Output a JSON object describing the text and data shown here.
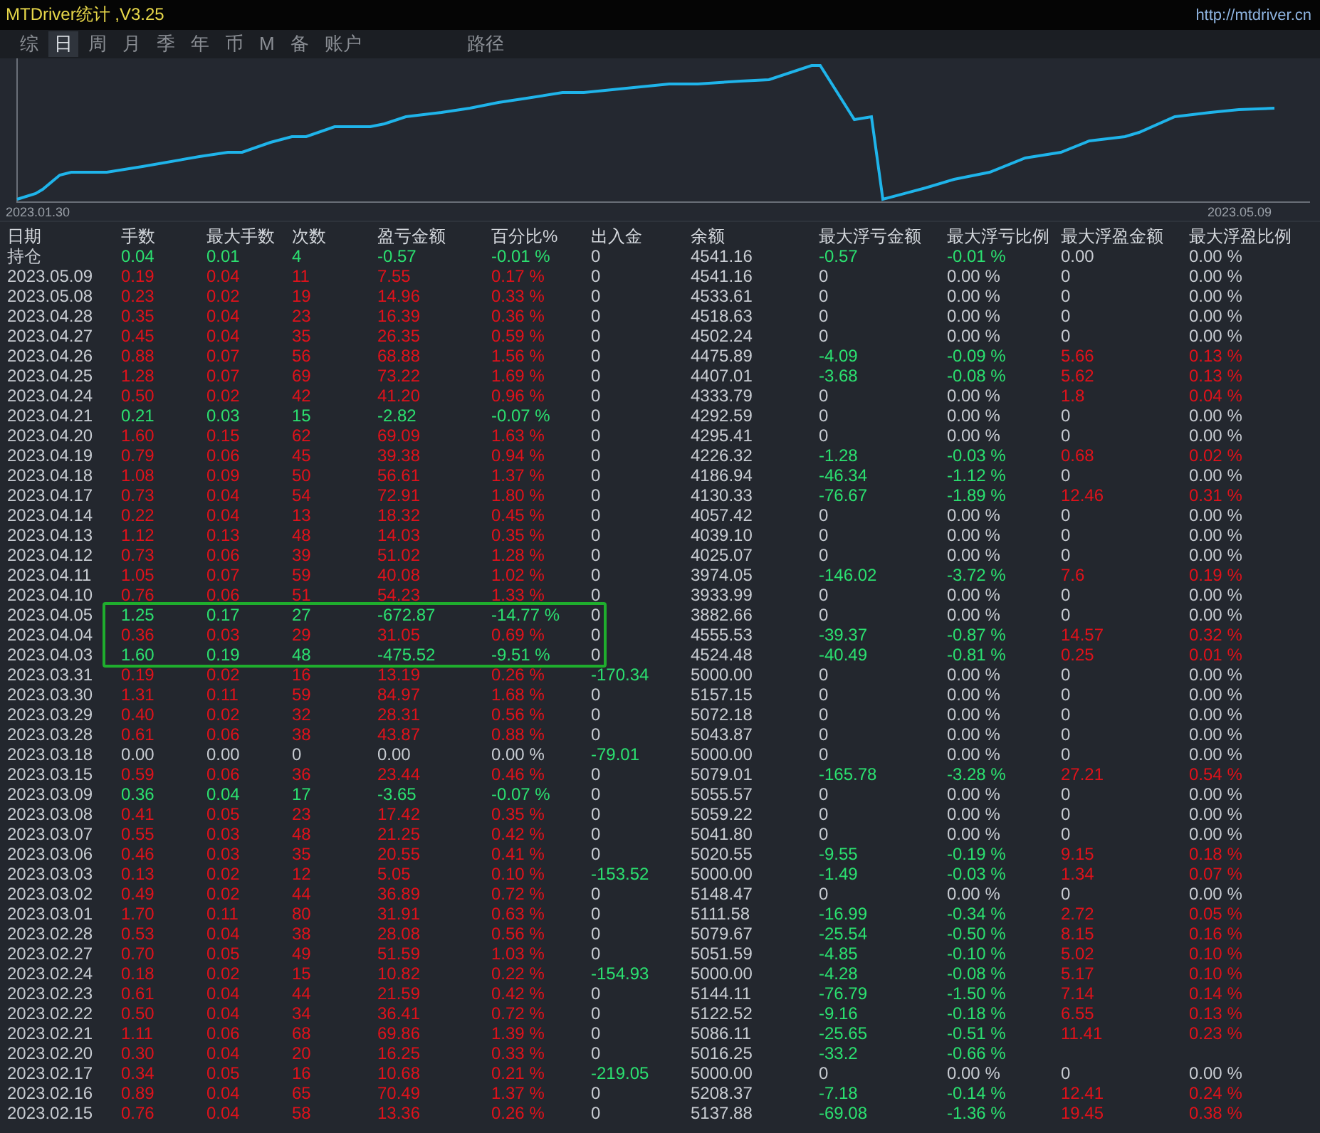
{
  "window": {
    "title": "MTDriver统计 ,V3.25",
    "url": "http://mtdriver.cn"
  },
  "tabs": [
    {
      "label": "综",
      "selected": false
    },
    {
      "label": "日",
      "selected": true
    },
    {
      "label": "周",
      "selected": false
    },
    {
      "label": "月",
      "selected": false
    },
    {
      "label": "季",
      "selected": false
    },
    {
      "label": "年",
      "selected": false
    },
    {
      "label": "币",
      "selected": false
    },
    {
      "label": "M",
      "selected": false
    },
    {
      "label": "备",
      "selected": false
    },
    {
      "label": "账户",
      "selected": false
    }
  ],
  "extra_tabs": [
    {
      "label": "路径",
      "selected": false
    }
  ],
  "chart": {
    "start_label": "2023.01.30",
    "end_label": "2023.05.09"
  },
  "columns": [
    "日期",
    "手数",
    "最大手数",
    "次数",
    "盈亏金额",
    "百分比%",
    "出入金",
    "余额",
    "最大浮亏金额",
    "最大浮亏比例",
    "最大浮盈金额",
    "最大浮盈比例"
  ],
  "rows": [
    {
      "date": "持仓",
      "highlighted": false,
      "cells": [
        {
          "text": "0.04",
          "color": "#2be070"
        },
        {
          "text": "0.01",
          "color": "#2be070"
        },
        {
          "text": "4",
          "color": "#2be070"
        },
        {
          "text": "-0.57",
          "color": "#2be070"
        },
        {
          "text": "-0.01 %",
          "color": "#2be070"
        },
        {
          "text": "0"
        },
        {
          "text": "4541.16"
        },
        {
          "text": "-0.57",
          "color": "#2be070"
        },
        {
          "text": "-0.01 %",
          "color": "#2be070"
        },
        {
          "text": "0.00"
        },
        {
          "text": "0.00 %"
        }
      ]
    },
    {
      "date": "2023.05.09",
      "highlighted": false,
      "cells": [
        {
          "text": "0.19",
          "color": "#e0121b"
        },
        {
          "text": "0.04",
          "color": "#e0121b"
        },
        {
          "text": "11",
          "color": "#e0121b"
        },
        {
          "text": "7.55",
          "color": "#e0121b"
        },
        {
          "text": "0.17 %",
          "color": "#e0121b"
        },
        {
          "text": "0"
        },
        {
          "text": "4541.16"
        },
        {
          "text": "0"
        },
        {
          "text": "0.00 %"
        },
        {
          "text": "0"
        },
        {
          "text": "0.00 %"
        }
      ]
    },
    {
      "date": "2023.05.08",
      "highlighted": false,
      "cells": [
        {
          "text": "0.23",
          "color": "#e0121b"
        },
        {
          "text": "0.02",
          "color": "#e0121b"
        },
        {
          "text": "19",
          "color": "#e0121b"
        },
        {
          "text": "14.96",
          "color": "#e0121b"
        },
        {
          "text": "0.33 %",
          "color": "#e0121b"
        },
        {
          "text": "0"
        },
        {
          "text": "4533.61"
        },
        {
          "text": "0"
        },
        {
          "text": "0.00 %"
        },
        {
          "text": "0"
        },
        {
          "text": "0.00 %"
        }
      ]
    },
    {
      "date": "2023.04.28",
      "highlighted": false,
      "cells": [
        {
          "text": "0.35",
          "color": "#e0121b"
        },
        {
          "text": "0.04",
          "color": "#e0121b"
        },
        {
          "text": "23",
          "color": "#e0121b"
        },
        {
          "text": "16.39",
          "color": "#e0121b"
        },
        {
          "text": "0.36 %",
          "color": "#e0121b"
        },
        {
          "text": "0"
        },
        {
          "text": "4518.63"
        },
        {
          "text": "0"
        },
        {
          "text": "0.00 %"
        },
        {
          "text": "0"
        },
        {
          "text": "0.00 %"
        }
      ]
    },
    {
      "date": "2023.04.27",
      "highlighted": false,
      "cells": [
        {
          "text": "0.45",
          "color": "#e0121b"
        },
        {
          "text": "0.04",
          "color": "#e0121b"
        },
        {
          "text": "35",
          "color": "#e0121b"
        },
        {
          "text": "26.35",
          "color": "#e0121b"
        },
        {
          "text": "0.59 %",
          "color": "#e0121b"
        },
        {
          "text": "0"
        },
        {
          "text": "4502.24"
        },
        {
          "text": "0"
        },
        {
          "text": "0.00 %"
        },
        {
          "text": "0"
        },
        {
          "text": "0.00 %"
        }
      ]
    },
    {
      "date": "2023.04.26",
      "highlighted": false,
      "cells": [
        {
          "text": "0.88",
          "color": "#e0121b"
        },
        {
          "text": "0.07",
          "color": "#e0121b"
        },
        {
          "text": "56",
          "color": "#e0121b"
        },
        {
          "text": "68.88",
          "color": "#e0121b"
        },
        {
          "text": "1.56 %",
          "color": "#e0121b"
        },
        {
          "text": "0"
        },
        {
          "text": "4475.89"
        },
        {
          "text": "-4.09",
          "color": "#2be070"
        },
        {
          "text": "-0.09 %",
          "color": "#2be070"
        },
        {
          "text": "5.66",
          "color": "#e0121b"
        },
        {
          "text": "0.13 %",
          "color": "#e0121b"
        }
      ]
    },
    {
      "date": "2023.04.25",
      "highlighted": false,
      "cells": [
        {
          "text": "1.28",
          "color": "#e0121b"
        },
        {
          "text": "0.07",
          "color": "#e0121b"
        },
        {
          "text": "69",
          "color": "#e0121b"
        },
        {
          "text": "73.22",
          "color": "#e0121b"
        },
        {
          "text": "1.69 %",
          "color": "#e0121b"
        },
        {
          "text": "0"
        },
        {
          "text": "4407.01"
        },
        {
          "text": "-3.68",
          "color": "#2be070"
        },
        {
          "text": "-0.08 %",
          "color": "#2be070"
        },
        {
          "text": "5.62",
          "color": "#e0121b"
        },
        {
          "text": "0.13 %",
          "color": "#e0121b"
        }
      ]
    },
    {
      "date": "2023.04.24",
      "highlighted": false,
      "cells": [
        {
          "text": "0.50",
          "color": "#e0121b"
        },
        {
          "text": "0.02",
          "color": "#e0121b"
        },
        {
          "text": "42",
          "color": "#e0121b"
        },
        {
          "text": "41.20",
          "color": "#e0121b"
        },
        {
          "text": "0.96 %",
          "color": "#e0121b"
        },
        {
          "text": "0"
        },
        {
          "text": "4333.79"
        },
        {
          "text": "0"
        },
        {
          "text": "0.00 %"
        },
        {
          "text": "1.8",
          "color": "#e0121b"
        },
        {
          "text": "0.04 %",
          "color": "#e0121b"
        }
      ]
    },
    {
      "date": "2023.04.21",
      "highlighted": false,
      "cells": [
        {
          "text": "0.21",
          "color": "#2be070"
        },
        {
          "text": "0.03",
          "color": "#2be070"
        },
        {
          "text": "15",
          "color": "#2be070"
        },
        {
          "text": "-2.82",
          "color": "#2be070"
        },
        {
          "text": "-0.07 %",
          "color": "#2be070"
        },
        {
          "text": "0"
        },
        {
          "text": "4292.59"
        },
        {
          "text": "0"
        },
        {
          "text": "0.00 %"
        },
        {
          "text": "0"
        },
        {
          "text": "0.00 %"
        }
      ]
    },
    {
      "date": "2023.04.20",
      "highlighted": false,
      "cells": [
        {
          "text": "1.60",
          "color": "#e0121b"
        },
        {
          "text": "0.15",
          "color": "#e0121b"
        },
        {
          "text": "62",
          "color": "#e0121b"
        },
        {
          "text": "69.09",
          "color": "#e0121b"
        },
        {
          "text": "1.63 %",
          "color": "#e0121b"
        },
        {
          "text": "0"
        },
        {
          "text": "4295.41"
        },
        {
          "text": "0"
        },
        {
          "text": "0.00 %"
        },
        {
          "text": "0"
        },
        {
          "text": "0.00 %"
        }
      ]
    },
    {
      "date": "2023.04.19",
      "highlighted": false,
      "cells": [
        {
          "text": "0.79",
          "color": "#e0121b"
        },
        {
          "text": "0.06",
          "color": "#e0121b"
        },
        {
          "text": "45",
          "color": "#e0121b"
        },
        {
          "text": "39.38",
          "color": "#e0121b"
        },
        {
          "text": "0.94 %",
          "color": "#e0121b"
        },
        {
          "text": "0"
        },
        {
          "text": "4226.32"
        },
        {
          "text": "-1.28",
          "color": "#2be070"
        },
        {
          "text": "-0.03 %",
          "color": "#2be070"
        },
        {
          "text": "0.68",
          "color": "#e0121b"
        },
        {
          "text": "0.02 %",
          "color": "#e0121b"
        }
      ]
    },
    {
      "date": "2023.04.18",
      "highlighted": false,
      "cells": [
        {
          "text": "1.08",
          "color": "#e0121b"
        },
        {
          "text": "0.09",
          "color": "#e0121b"
        },
        {
          "text": "50",
          "color": "#e0121b"
        },
        {
          "text": "56.61",
          "color": "#e0121b"
        },
        {
          "text": "1.37 %",
          "color": "#e0121b"
        },
        {
          "text": "0"
        },
        {
          "text": "4186.94"
        },
        {
          "text": "-46.34",
          "color": "#2be070"
        },
        {
          "text": "-1.12 %",
          "color": "#2be070"
        },
        {
          "text": "0"
        },
        {
          "text": "0.00 %"
        }
      ]
    },
    {
      "date": "2023.04.17",
      "highlighted": false,
      "cells": [
        {
          "text": "0.73",
          "color": "#e0121b"
        },
        {
          "text": "0.04",
          "color": "#e0121b"
        },
        {
          "text": "54",
          "color": "#e0121b"
        },
        {
          "text": "72.91",
          "color": "#e0121b"
        },
        {
          "text": "1.80 %",
          "color": "#e0121b"
        },
        {
          "text": "0"
        },
        {
          "text": "4130.33"
        },
        {
          "text": "-76.67",
          "color": "#2be070"
        },
        {
          "text": "-1.89 %",
          "color": "#2be070"
        },
        {
          "text": "12.46",
          "color": "#e0121b"
        },
        {
          "text": "0.31 %",
          "color": "#e0121b"
        }
      ]
    },
    {
      "date": "2023.04.14",
      "highlighted": false,
      "cells": [
        {
          "text": "0.22",
          "color": "#e0121b"
        },
        {
          "text": "0.04",
          "color": "#e0121b"
        },
        {
          "text": "13",
          "color": "#e0121b"
        },
        {
          "text": "18.32",
          "color": "#e0121b"
        },
        {
          "text": "0.45 %",
          "color": "#e0121b"
        },
        {
          "text": "0"
        },
        {
          "text": "4057.42"
        },
        {
          "text": "0"
        },
        {
          "text": "0.00 %"
        },
        {
          "text": "0"
        },
        {
          "text": "0.00 %"
        }
      ]
    },
    {
      "date": "2023.04.13",
      "highlighted": false,
      "cells": [
        {
          "text": "1.12",
          "color": "#e0121b"
        },
        {
          "text": "0.13",
          "color": "#e0121b"
        },
        {
          "text": "48",
          "color": "#e0121b"
        },
        {
          "text": "14.03",
          "color": "#e0121b"
        },
        {
          "text": "0.35 %",
          "color": "#e0121b"
        },
        {
          "text": "0"
        },
        {
          "text": "4039.10"
        },
        {
          "text": "0"
        },
        {
          "text": "0.00 %"
        },
        {
          "text": "0"
        },
        {
          "text": "0.00 %"
        }
      ]
    },
    {
      "date": "2023.04.12",
      "highlighted": false,
      "cells": [
        {
          "text": "0.73",
          "color": "#e0121b"
        },
        {
          "text": "0.06",
          "color": "#e0121b"
        },
        {
          "text": "39",
          "color": "#e0121b"
        },
        {
          "text": "51.02",
          "color": "#e0121b"
        },
        {
          "text": "1.28 %",
          "color": "#e0121b"
        },
        {
          "text": "0"
        },
        {
          "text": "4025.07"
        },
        {
          "text": "0"
        },
        {
          "text": "0.00 %"
        },
        {
          "text": "0"
        },
        {
          "text": "0.00 %"
        }
      ]
    },
    {
      "date": "2023.04.11",
      "highlighted": false,
      "cells": [
        {
          "text": "1.05",
          "color": "#e0121b"
        },
        {
          "text": "0.07",
          "color": "#e0121b"
        },
        {
          "text": "59",
          "color": "#e0121b"
        },
        {
          "text": "40.08",
          "color": "#e0121b"
        },
        {
          "text": "1.02 %",
          "color": "#e0121b"
        },
        {
          "text": "0"
        },
        {
          "text": "3974.05"
        },
        {
          "text": "-146.02",
          "color": "#2be070"
        },
        {
          "text": "-3.72 %",
          "color": "#2be070"
        },
        {
          "text": "7.6",
          "color": "#e0121b"
        },
        {
          "text": "0.19 %",
          "color": "#e0121b"
        }
      ]
    },
    {
      "date": "2023.04.10",
      "highlighted": false,
      "cells": [
        {
          "text": "0.76",
          "color": "#e0121b"
        },
        {
          "text": "0.06",
          "color": "#e0121b"
        },
        {
          "text": "51",
          "color": "#e0121b"
        },
        {
          "text": "54.23",
          "color": "#e0121b"
        },
        {
          "text": "1.33 %",
          "color": "#e0121b"
        },
        {
          "text": "0"
        },
        {
          "text": "3933.99"
        },
        {
          "text": "0"
        },
        {
          "text": "0.00 %"
        },
        {
          "text": "0"
        },
        {
          "text": "0.00 %"
        }
      ]
    },
    {
      "date": "2023.04.05",
      "highlighted": true,
      "cells": [
        {
          "text": "1.25",
          "color": "#2be070"
        },
        {
          "text": "0.17",
          "color": "#2be070"
        },
        {
          "text": "27",
          "color": "#2be070"
        },
        {
          "text": "-672.87",
          "color": "#2be070"
        },
        {
          "text": "-14.77 %",
          "color": "#2be070"
        },
        {
          "text": "0"
        },
        {
          "text": "3882.66"
        },
        {
          "text": "0"
        },
        {
          "text": "0.00 %"
        },
        {
          "text": "0"
        },
        {
          "text": "0.00 %"
        }
      ]
    },
    {
      "date": "2023.04.04",
      "highlighted": true,
      "cells": [
        {
          "text": "0.36",
          "color": "#e0121b"
        },
        {
          "text": "0.03",
          "color": "#e0121b"
        },
        {
          "text": "29",
          "color": "#e0121b"
        },
        {
          "text": "31.05",
          "color": "#e0121b"
        },
        {
          "text": "0.69 %",
          "color": "#e0121b"
        },
        {
          "text": "0"
        },
        {
          "text": "4555.53"
        },
        {
          "text": "-39.37",
          "color": "#2be070"
        },
        {
          "text": "-0.87 %",
          "color": "#2be070"
        },
        {
          "text": "14.57",
          "color": "#e0121b"
        },
        {
          "text": "0.32 %",
          "color": "#e0121b"
        }
      ]
    },
    {
      "date": "2023.04.03",
      "highlighted": true,
      "cells": [
        {
          "text": "1.60",
          "color": "#2be070"
        },
        {
          "text": "0.19",
          "color": "#2be070"
        },
        {
          "text": "48",
          "color": "#2be070"
        },
        {
          "text": "-475.52",
          "color": "#2be070"
        },
        {
          "text": "-9.51 %",
          "color": "#2be070"
        },
        {
          "text": "0"
        },
        {
          "text": "4524.48"
        },
        {
          "text": "-40.49",
          "color": "#2be070"
        },
        {
          "text": "-0.81 %",
          "color": "#2be070"
        },
        {
          "text": "0.25",
          "color": "#e0121b"
        },
        {
          "text": "0.01 %",
          "color": "#e0121b"
        }
      ]
    },
    {
      "date": "2023.03.31",
      "highlighted": false,
      "cells": [
        {
          "text": "0.19",
          "color": "#e0121b"
        },
        {
          "text": "0.02",
          "color": "#e0121b"
        },
        {
          "text": "16",
          "color": "#e0121b"
        },
        {
          "text": "13.19",
          "color": "#e0121b"
        },
        {
          "text": "0.26 %",
          "color": "#e0121b"
        },
        {
          "text": "-170.34",
          "color": "#2be070"
        },
        {
          "text": "5000.00"
        },
        {
          "text": "0"
        },
        {
          "text": "0.00 %"
        },
        {
          "text": "0"
        },
        {
          "text": "0.00 %"
        }
      ]
    },
    {
      "date": "2023.03.30",
      "highlighted": false,
      "cells": [
        {
          "text": "1.31",
          "color": "#e0121b"
        },
        {
          "text": "0.11",
          "color": "#e0121b"
        },
        {
          "text": "59",
          "color": "#e0121b"
        },
        {
          "text": "84.97",
          "color": "#e0121b"
        },
        {
          "text": "1.68 %",
          "color": "#e0121b"
        },
        {
          "text": "0"
        },
        {
          "text": "5157.15"
        },
        {
          "text": "0"
        },
        {
          "text": "0.00 %"
        },
        {
          "text": "0"
        },
        {
          "text": "0.00 %"
        }
      ]
    },
    {
      "date": "2023.03.29",
      "highlighted": false,
      "cells": [
        {
          "text": "0.40",
          "color": "#e0121b"
        },
        {
          "text": "0.02",
          "color": "#e0121b"
        },
        {
          "text": "32",
          "color": "#e0121b"
        },
        {
          "text": "28.31",
          "color": "#e0121b"
        },
        {
          "text": "0.56 %",
          "color": "#e0121b"
        },
        {
          "text": "0"
        },
        {
          "text": "5072.18"
        },
        {
          "text": "0"
        },
        {
          "text": "0.00 %"
        },
        {
          "text": "0"
        },
        {
          "text": "0.00 %"
        }
      ]
    },
    {
      "date": "2023.03.28",
      "highlighted": false,
      "cells": [
        {
          "text": "0.61",
          "color": "#e0121b"
        },
        {
          "text": "0.06",
          "color": "#e0121b"
        },
        {
          "text": "38",
          "color": "#e0121b"
        },
        {
          "text": "43.87",
          "color": "#e0121b"
        },
        {
          "text": "0.88 %",
          "color": "#e0121b"
        },
        {
          "text": "0"
        },
        {
          "text": "5043.87"
        },
        {
          "text": "0"
        },
        {
          "text": "0.00 %"
        },
        {
          "text": "0"
        },
        {
          "text": "0.00 %"
        }
      ]
    },
    {
      "date": "2023.03.18",
      "highlighted": false,
      "cells": [
        {
          "text": "0.00"
        },
        {
          "text": "0.00"
        },
        {
          "text": "0"
        },
        {
          "text": "0.00"
        },
        {
          "text": "0.00 %"
        },
        {
          "text": "-79.01",
          "color": "#2be070"
        },
        {
          "text": "5000.00"
        },
        {
          "text": "0"
        },
        {
          "text": "0.00 %"
        },
        {
          "text": "0"
        },
        {
          "text": "0.00 %"
        }
      ]
    },
    {
      "date": "2023.03.15",
      "highlighted": false,
      "cells": [
        {
          "text": "0.59",
          "color": "#e0121b"
        },
        {
          "text": "0.06",
          "color": "#e0121b"
        },
        {
          "text": "36",
          "color": "#e0121b"
        },
        {
          "text": "23.44",
          "color": "#e0121b"
        },
        {
          "text": "0.46 %",
          "color": "#e0121b"
        },
        {
          "text": "0"
        },
        {
          "text": "5079.01"
        },
        {
          "text": "-165.78",
          "color": "#2be070"
        },
        {
          "text": "-3.28 %",
          "color": "#2be070"
        },
        {
          "text": "27.21",
          "color": "#e0121b"
        },
        {
          "text": "0.54 %",
          "color": "#e0121b"
        }
      ]
    },
    {
      "date": "2023.03.09",
      "highlighted": false,
      "cells": [
        {
          "text": "0.36",
          "color": "#2be070"
        },
        {
          "text": "0.04",
          "color": "#2be070"
        },
        {
          "text": "17",
          "color": "#2be070"
        },
        {
          "text": "-3.65",
          "color": "#2be070"
        },
        {
          "text": "-0.07 %",
          "color": "#2be070"
        },
        {
          "text": "0"
        },
        {
          "text": "5055.57"
        },
        {
          "text": "0"
        },
        {
          "text": "0.00 %"
        },
        {
          "text": "0"
        },
        {
          "text": "0.00 %"
        }
      ]
    },
    {
      "date": "2023.03.08",
      "highlighted": false,
      "cells": [
        {
          "text": "0.41",
          "color": "#e0121b"
        },
        {
          "text": "0.05",
          "color": "#e0121b"
        },
        {
          "text": "23",
          "color": "#e0121b"
        },
        {
          "text": "17.42",
          "color": "#e0121b"
        },
        {
          "text": "0.35 %",
          "color": "#e0121b"
        },
        {
          "text": "0"
        },
        {
          "text": "5059.22"
        },
        {
          "text": "0"
        },
        {
          "text": "0.00 %"
        },
        {
          "text": "0"
        },
        {
          "text": "0.00 %"
        }
      ]
    },
    {
      "date": "2023.03.07",
      "highlighted": false,
      "cells": [
        {
          "text": "0.55",
          "color": "#e0121b"
        },
        {
          "text": "0.03",
          "color": "#e0121b"
        },
        {
          "text": "48",
          "color": "#e0121b"
        },
        {
          "text": "21.25",
          "color": "#e0121b"
        },
        {
          "text": "0.42 %",
          "color": "#e0121b"
        },
        {
          "text": "0"
        },
        {
          "text": "5041.80"
        },
        {
          "text": "0"
        },
        {
          "text": "0.00 %"
        },
        {
          "text": "0"
        },
        {
          "text": "0.00 %"
        }
      ]
    },
    {
      "date": "2023.03.06",
      "highlighted": false,
      "cells": [
        {
          "text": "0.46",
          "color": "#e0121b"
        },
        {
          "text": "0.03",
          "color": "#e0121b"
        },
        {
          "text": "35",
          "color": "#e0121b"
        },
        {
          "text": "20.55",
          "color": "#e0121b"
        },
        {
          "text": "0.41 %",
          "color": "#e0121b"
        },
        {
          "text": "0"
        },
        {
          "text": "5020.55"
        },
        {
          "text": "-9.55",
          "color": "#2be070"
        },
        {
          "text": "-0.19 %",
          "color": "#2be070"
        },
        {
          "text": "9.15",
          "color": "#e0121b"
        },
        {
          "text": "0.18 %",
          "color": "#e0121b"
        }
      ]
    },
    {
      "date": "2023.03.03",
      "highlighted": false,
      "cells": [
        {
          "text": "0.13",
          "color": "#e0121b"
        },
        {
          "text": "0.02",
          "color": "#e0121b"
        },
        {
          "text": "12",
          "color": "#e0121b"
        },
        {
          "text": "5.05",
          "color": "#e0121b"
        },
        {
          "text": "0.10 %",
          "color": "#e0121b"
        },
        {
          "text": "-153.52",
          "color": "#2be070"
        },
        {
          "text": "5000.00"
        },
        {
          "text": "-1.49",
          "color": "#2be070"
        },
        {
          "text": "-0.03 %",
          "color": "#2be070"
        },
        {
          "text": "1.34",
          "color": "#e0121b"
        },
        {
          "text": "0.07 %",
          "color": "#e0121b"
        }
      ]
    },
    {
      "date": "2023.03.02",
      "highlighted": false,
      "cells": [
        {
          "text": "0.49",
          "color": "#e0121b"
        },
        {
          "text": "0.02",
          "color": "#e0121b"
        },
        {
          "text": "44",
          "color": "#e0121b"
        },
        {
          "text": "36.89",
          "color": "#e0121b"
        },
        {
          "text": "0.72 %",
          "color": "#e0121b"
        },
        {
          "text": "0"
        },
        {
          "text": "5148.47"
        },
        {
          "text": "0"
        },
        {
          "text": "0.00 %"
        },
        {
          "text": "0"
        },
        {
          "text": "0.00 %"
        }
      ]
    },
    {
      "date": "2023.03.01",
      "highlighted": false,
      "cells": [
        {
          "text": "1.70",
          "color": "#e0121b"
        },
        {
          "text": "0.11",
          "color": "#e0121b"
        },
        {
          "text": "80",
          "color": "#e0121b"
        },
        {
          "text": "31.91",
          "color": "#e0121b"
        },
        {
          "text": "0.63 %",
          "color": "#e0121b"
        },
        {
          "text": "0"
        },
        {
          "text": "5111.58"
        },
        {
          "text": "-16.99",
          "color": "#2be070"
        },
        {
          "text": "-0.34 %",
          "color": "#2be070"
        },
        {
          "text": "2.72",
          "color": "#e0121b"
        },
        {
          "text": "0.05 %",
          "color": "#e0121b"
        }
      ]
    },
    {
      "date": "2023.02.28",
      "highlighted": false,
      "cells": [
        {
          "text": "0.53",
          "color": "#e0121b"
        },
        {
          "text": "0.04",
          "color": "#e0121b"
        },
        {
          "text": "38",
          "color": "#e0121b"
        },
        {
          "text": "28.08",
          "color": "#e0121b"
        },
        {
          "text": "0.56 %",
          "color": "#e0121b"
        },
        {
          "text": "0"
        },
        {
          "text": "5079.67"
        },
        {
          "text": "-25.54",
          "color": "#2be070"
        },
        {
          "text": "-0.50 %",
          "color": "#2be070"
        },
        {
          "text": "8.15",
          "color": "#e0121b"
        },
        {
          "text": "0.16 %",
          "color": "#e0121b"
        }
      ]
    },
    {
      "date": "2023.02.27",
      "highlighted": false,
      "cells": [
        {
          "text": "0.70",
          "color": "#e0121b"
        },
        {
          "text": "0.05",
          "color": "#e0121b"
        },
        {
          "text": "49",
          "color": "#e0121b"
        },
        {
          "text": "51.59",
          "color": "#e0121b"
        },
        {
          "text": "1.03 %",
          "color": "#e0121b"
        },
        {
          "text": "0"
        },
        {
          "text": "5051.59"
        },
        {
          "text": "-4.85",
          "color": "#2be070"
        },
        {
          "text": "-0.10 %",
          "color": "#2be070"
        },
        {
          "text": "5.02",
          "color": "#e0121b"
        },
        {
          "text": "0.10 %",
          "color": "#e0121b"
        }
      ]
    },
    {
      "date": "2023.02.24",
      "highlighted": false,
      "cells": [
        {
          "text": "0.18",
          "color": "#e0121b"
        },
        {
          "text": "0.02",
          "color": "#e0121b"
        },
        {
          "text": "15",
          "color": "#e0121b"
        },
        {
          "text": "10.82",
          "color": "#e0121b"
        },
        {
          "text": "0.22 %",
          "color": "#e0121b"
        },
        {
          "text": "-154.93",
          "color": "#2be070"
        },
        {
          "text": "5000.00"
        },
        {
          "text": "-4.28",
          "color": "#2be070"
        },
        {
          "text": "-0.08 %",
          "color": "#2be070"
        },
        {
          "text": "5.17",
          "color": "#e0121b"
        },
        {
          "text": "0.10 %",
          "color": "#e0121b"
        }
      ]
    },
    {
      "date": "2023.02.23",
      "highlighted": false,
      "cells": [
        {
          "text": "0.61",
          "color": "#e0121b"
        },
        {
          "text": "0.04",
          "color": "#e0121b"
        },
        {
          "text": "44",
          "color": "#e0121b"
        },
        {
          "text": "21.59",
          "color": "#e0121b"
        },
        {
          "text": "0.42 %",
          "color": "#e0121b"
        },
        {
          "text": "0"
        },
        {
          "text": "5144.11"
        },
        {
          "text": "-76.79",
          "color": "#2be070"
        },
        {
          "text": "-1.50 %",
          "color": "#2be070"
        },
        {
          "text": "7.14",
          "color": "#e0121b"
        },
        {
          "text": "0.14 %",
          "color": "#e0121b"
        }
      ]
    },
    {
      "date": "2023.02.22",
      "highlighted": false,
      "cells": [
        {
          "text": "0.50",
          "color": "#e0121b"
        },
        {
          "text": "0.04",
          "color": "#e0121b"
        },
        {
          "text": "34",
          "color": "#e0121b"
        },
        {
          "text": "36.41",
          "color": "#e0121b"
        },
        {
          "text": "0.72 %",
          "color": "#e0121b"
        },
        {
          "text": "0"
        },
        {
          "text": "5122.52"
        },
        {
          "text": "-9.16",
          "color": "#2be070"
        },
        {
          "text": "-0.18 %",
          "color": "#2be070"
        },
        {
          "text": "6.55",
          "color": "#e0121b"
        },
        {
          "text": "0.13 %",
          "color": "#e0121b"
        }
      ]
    },
    {
      "date": "2023.02.21",
      "highlighted": false,
      "cells": [
        {
          "text": "1.11",
          "color": "#e0121b"
        },
        {
          "text": "0.06",
          "color": "#e0121b"
        },
        {
          "text": "68",
          "color": "#e0121b"
        },
        {
          "text": "69.86",
          "color": "#e0121b"
        },
        {
          "text": "1.39 %",
          "color": "#e0121b"
        },
        {
          "text": "0"
        },
        {
          "text": "5086.11"
        },
        {
          "text": "-25.65",
          "color": "#2be070"
        },
        {
          "text": "-0.51 %",
          "color": "#2be070"
        },
        {
          "text": "11.41",
          "color": "#e0121b"
        },
        {
          "text": "0.23 %",
          "color": "#e0121b"
        }
      ]
    },
    {
      "date": "2023.02.20",
      "highlighted": false,
      "cells": [
        {
          "text": "0.30",
          "color": "#e0121b"
        },
        {
          "text": "0.04",
          "color": "#e0121b"
        },
        {
          "text": "20",
          "color": "#e0121b"
        },
        {
          "text": "16.25",
          "color": "#e0121b"
        },
        {
          "text": "0.33 %",
          "color": "#e0121b"
        },
        {
          "text": "0"
        },
        {
          "text": "5016.25"
        },
        {
          "text": "-33.2",
          "color": "#2be070"
        },
        {
          "text": "-0.66 %",
          "color": "#2be070"
        }
      ]
    },
    {
      "date": "2023.02.17",
      "highlighted": false,
      "cells": [
        {
          "text": "0.34",
          "color": "#e0121b"
        },
        {
          "text": "0.05",
          "color": "#e0121b"
        },
        {
          "text": "16",
          "color": "#e0121b"
        },
        {
          "text": "10.68",
          "color": "#e0121b"
        },
        {
          "text": "0.21 %",
          "color": "#e0121b"
        },
        {
          "text": "-219.05",
          "color": "#2be070"
        },
        {
          "text": "5000.00"
        },
        {
          "text": "0"
        },
        {
          "text": "0.00 %"
        },
        {
          "text": "0"
        },
        {
          "text": "0.00 %"
        }
      ]
    },
    {
      "date": "2023.02.16",
      "highlighted": false,
      "cells": [
        {
          "text": "0.89",
          "color": "#e0121b"
        },
        {
          "text": "0.04",
          "color": "#e0121b"
        },
        {
          "text": "65",
          "color": "#e0121b"
        },
        {
          "text": "70.49",
          "color": "#e0121b"
        },
        {
          "text": "1.37 %",
          "color": "#e0121b"
        },
        {
          "text": "0"
        },
        {
          "text": "5208.37"
        },
        {
          "text": "-7.18",
          "color": "#2be070"
        },
        {
          "text": "-0.14 %",
          "color": "#2be070"
        },
        {
          "text": "12.41",
          "color": "#e0121b"
        },
        {
          "text": "0.24 %",
          "color": "#e0121b"
        }
      ]
    },
    {
      "date": "2023.02.15",
      "highlighted": false,
      "cells": [
        {
          "text": "0.76",
          "color": "#e0121b"
        },
        {
          "text": "0.04",
          "color": "#e0121b"
        },
        {
          "text": "58",
          "color": "#e0121b"
        },
        {
          "text": "13.36",
          "color": "#e0121b"
        },
        {
          "text": "0.26 %",
          "color": "#e0121b"
        },
        {
          "text": "0"
        },
        {
          "text": "5137.88"
        },
        {
          "text": "-69.08",
          "color": "#2be070"
        },
        {
          "text": "-1.36 %",
          "color": "#2be070"
        },
        {
          "text": "19.45",
          "color": "#e0121b"
        },
        {
          "text": "0.38 %",
          "color": "#e0121b"
        }
      ]
    }
  ]
}
